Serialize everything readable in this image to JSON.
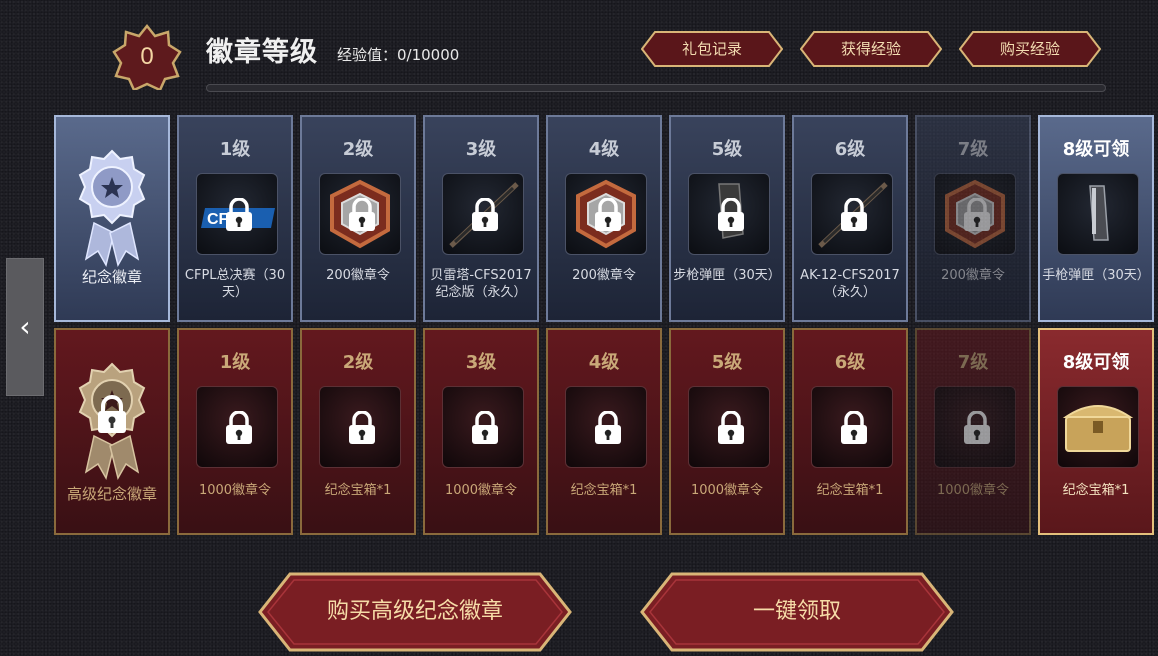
{
  "header": {
    "level": "0",
    "title": "徽章等级",
    "exp_text": "经验值：0/10000",
    "exp_progress": 0,
    "buttons": [
      "礼包记录",
      "获得经验",
      "购买经验"
    ]
  },
  "nav": {
    "prev_icon": "chevron-left-icon"
  },
  "badges": {
    "normal_label": "纪念徽章",
    "premium_label": "高级纪念徽章"
  },
  "levels": [
    "1级",
    "2级",
    "3级",
    "4级",
    "5级",
    "6级",
    "7级",
    "8级可领"
  ],
  "normal_rewards": [
    {
      "name": "CFPL总决赛（30天）",
      "icon": "cfpl-logo-icon",
      "locked": true
    },
    {
      "name": "200徽章令",
      "icon": "badge-token-icon",
      "locked": true
    },
    {
      "name": "贝雷塔-CFS2017纪念版（永久）",
      "icon": "rifle-icon",
      "locked": true
    },
    {
      "name": "200徽章令",
      "icon": "badge-token-icon",
      "locked": true
    },
    {
      "name": "步枪弹匣（30天）",
      "icon": "magazine-icon",
      "locked": true
    },
    {
      "name": "AK-12-CFS2017（永久）",
      "icon": "rifle-icon",
      "locked": true
    },
    {
      "name": "200徽章令",
      "icon": "badge-token-icon",
      "locked": true
    },
    {
      "name": "手枪弹匣（30天）",
      "icon": "pistol-magazine-icon",
      "locked": false
    }
  ],
  "premium_rewards": [
    {
      "name": "1000徽章令",
      "locked": true
    },
    {
      "name": "纪念宝箱*1",
      "locked": true
    },
    {
      "name": "1000徽章令",
      "locked": true
    },
    {
      "name": "纪念宝箱*1",
      "locked": true
    },
    {
      "name": "1000徽章令",
      "locked": true
    },
    {
      "name": "纪念宝箱*1",
      "locked": true
    },
    {
      "name": "1000徽章令",
      "locked": true
    },
    {
      "name": "纪念宝箱*1",
      "icon": "treasure-chest-icon",
      "locked": false
    }
  ],
  "footer": {
    "buy_label": "购买高级纪念徽章",
    "claim_label": "一键领取"
  },
  "colors": {
    "accent_gold": "#e4c07c",
    "normal_row": "#39435c",
    "premium_row": "#63181e"
  }
}
